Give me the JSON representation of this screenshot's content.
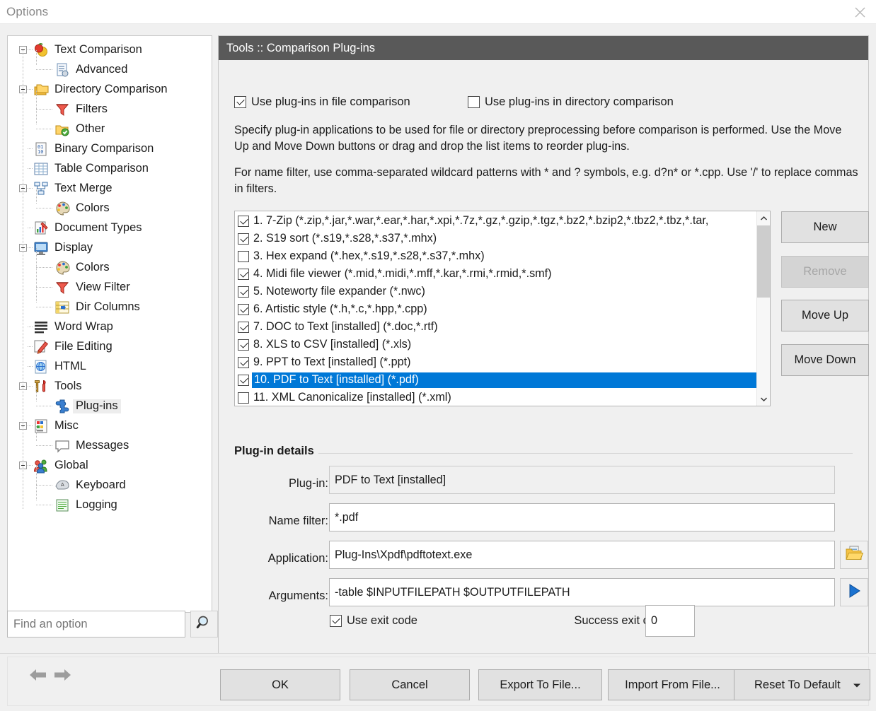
{
  "window": {
    "title": "Options",
    "close_icon": "close-icon"
  },
  "sidebar": {
    "items": [
      {
        "label": "Text Comparison",
        "icon": "fruit-icon",
        "depth": 0,
        "expander": "minus"
      },
      {
        "label": "Advanced",
        "icon": "document-gear-icon",
        "depth": 1,
        "expander": "none"
      },
      {
        "label": "Directory Comparison",
        "icon": "folders-icon",
        "depth": 0,
        "expander": "minus"
      },
      {
        "label": "Filters",
        "icon": "funnel-icon",
        "depth": 1,
        "expander": "none"
      },
      {
        "label": "Other",
        "icon": "folder-check-icon",
        "depth": 1,
        "expander": "none"
      },
      {
        "label": "Binary Comparison",
        "icon": "binary-icon",
        "depth": 0,
        "expander": "none"
      },
      {
        "label": "Table Comparison",
        "icon": "table-icon",
        "depth": 0,
        "expander": "none"
      },
      {
        "label": "Text Merge",
        "icon": "merge-tree-icon",
        "depth": 0,
        "expander": "minus"
      },
      {
        "label": "Colors",
        "icon": "palette-icon",
        "depth": 1,
        "expander": "none"
      },
      {
        "label": "Document Types",
        "icon": "doc-chart-icon",
        "depth": 0,
        "expander": "none"
      },
      {
        "label": "Display",
        "icon": "monitor-icon",
        "depth": 0,
        "expander": "minus"
      },
      {
        "label": "Colors",
        "icon": "palette-icon",
        "depth": 1,
        "expander": "none"
      },
      {
        "label": "View Filter",
        "icon": "funnel-icon",
        "depth": 1,
        "expander": "none"
      },
      {
        "label": "Dir Columns",
        "icon": "columns-icon",
        "depth": 1,
        "expander": "none"
      },
      {
        "label": "Word Wrap",
        "icon": "lines-icon",
        "depth": 0,
        "expander": "none"
      },
      {
        "label": "File Editing",
        "icon": "pencil-icon",
        "depth": 0,
        "expander": "none"
      },
      {
        "label": "HTML",
        "icon": "globe-page-icon",
        "depth": 0,
        "expander": "none"
      },
      {
        "label": "Tools",
        "icon": "tools-icon",
        "depth": 0,
        "expander": "minus"
      },
      {
        "label": "Plug-ins",
        "icon": "puzzle-icon",
        "depth": 1,
        "expander": "none",
        "selected": true
      },
      {
        "label": "Misc",
        "icon": "misc-icon",
        "depth": 0,
        "expander": "minus"
      },
      {
        "label": "Messages",
        "icon": "balloon-icon",
        "depth": 1,
        "expander": "none"
      },
      {
        "label": "Global",
        "icon": "people-icon",
        "depth": 0,
        "expander": "minus"
      },
      {
        "label": "Keyboard",
        "icon": "keyboard-icon",
        "depth": 1,
        "expander": "none"
      },
      {
        "label": "Logging",
        "icon": "log-icon",
        "depth": 1,
        "expander": "none"
      }
    ]
  },
  "search": {
    "placeholder": "Find an option",
    "value": "",
    "button_icon": "search-icon"
  },
  "content": {
    "header": "Tools :: Comparison Plug-ins",
    "checkbox_file": {
      "label": "Use plug-ins in file comparison",
      "checked": true
    },
    "checkbox_dir": {
      "label": "Use plug-ins in directory comparison",
      "checked": false
    },
    "desc1": "Specify plug-in applications to be used for file or directory preprocessing before comparison is performed. Use the Move Up and Move Down buttons or drag and drop the list items to reorder plug-ins.",
    "desc2": "For name filter, use comma-separated wildcard patterns with * and ? symbols, e.g. d?n* or *.cpp. Use '/' to replace commas in filters."
  },
  "plugins": {
    "selected_index": 9,
    "items": [
      {
        "num": "1.",
        "label": "7-Zip (*.zip,*.jar,*.war,*.ear,*.har,*.xpi,*.7z,*.gz,*.gzip,*.tgz,*.bz2,*.bzip2,*.tbz2,*.tbz,*.tar,",
        "checked": true
      },
      {
        "num": "2.",
        "label": "S19 sort (*.s19,*.s28,*.s37,*.mhx)",
        "checked": true
      },
      {
        "num": "3.",
        "label": "Hex expand (*.hex,*.s19,*.s28,*.s37,*.mhx)",
        "checked": false
      },
      {
        "num": "4.",
        "label": "Midi file viewer (*.mid,*.midi,*.mff,*.kar,*.rmi,*.rmid,*.smf)",
        "checked": true
      },
      {
        "num": "5.",
        "label": "Noteworty file expander (*.nwc)",
        "checked": true
      },
      {
        "num": "6.",
        "label": "Artistic style (*.h,*.c,*.hpp,*.cpp)",
        "checked": true
      },
      {
        "num": "7.",
        "label": "DOC to Text [installed] (*.doc,*.rtf)",
        "checked": true
      },
      {
        "num": "8.",
        "label": "XLS to CSV [installed] (*.xls)",
        "checked": true
      },
      {
        "num": "9.",
        "label": "PPT to Text [installed] (*.ppt)",
        "checked": true
      },
      {
        "num": "10.",
        "label": "PDF to Text [installed] (*.pdf)",
        "checked": true,
        "selected": true
      },
      {
        "num": "11.",
        "label": "XML Canonicalize [installed] (*.xml)",
        "checked": false
      }
    ]
  },
  "list_buttons": {
    "new": "New",
    "remove": "Remove",
    "remove_disabled": true,
    "move_up": "Move Up",
    "move_down": "Move Down"
  },
  "details": {
    "group_title": "Plug-in details",
    "plugin_label": "Plug-in:",
    "plugin_value": "PDF to Text [installed]",
    "name_filter_label": "Name filter:",
    "name_filter_value": "*.pdf",
    "application_label": "Application:",
    "application_value": "Plug-Ins\\Xpdf\\pdftotext.exe",
    "browse_icon": "folder-open-icon",
    "arguments_label": "Arguments:",
    "arguments_value": "-table $INPUTFILEPATH $OUTPUTFILEPATH",
    "run_icon": "play-icon",
    "use_exit_code": {
      "label": "Use exit code",
      "checked": true
    },
    "success_exit_code_label": "Success exit code:",
    "success_exit_code_value": "0"
  },
  "footer": {
    "back_icon": "arrow-left-icon",
    "forward_icon": "arrow-right-icon",
    "ok": "OK",
    "cancel": "Cancel",
    "export": "Export To File...",
    "import": "Import From File...",
    "reset": "Reset To Default",
    "reset_caret": "dropdown-caret-icon"
  },
  "colors": {
    "header_bg": "#595959",
    "selection_blue": "#0078d7",
    "panel_bg": "#f0f0f0"
  }
}
